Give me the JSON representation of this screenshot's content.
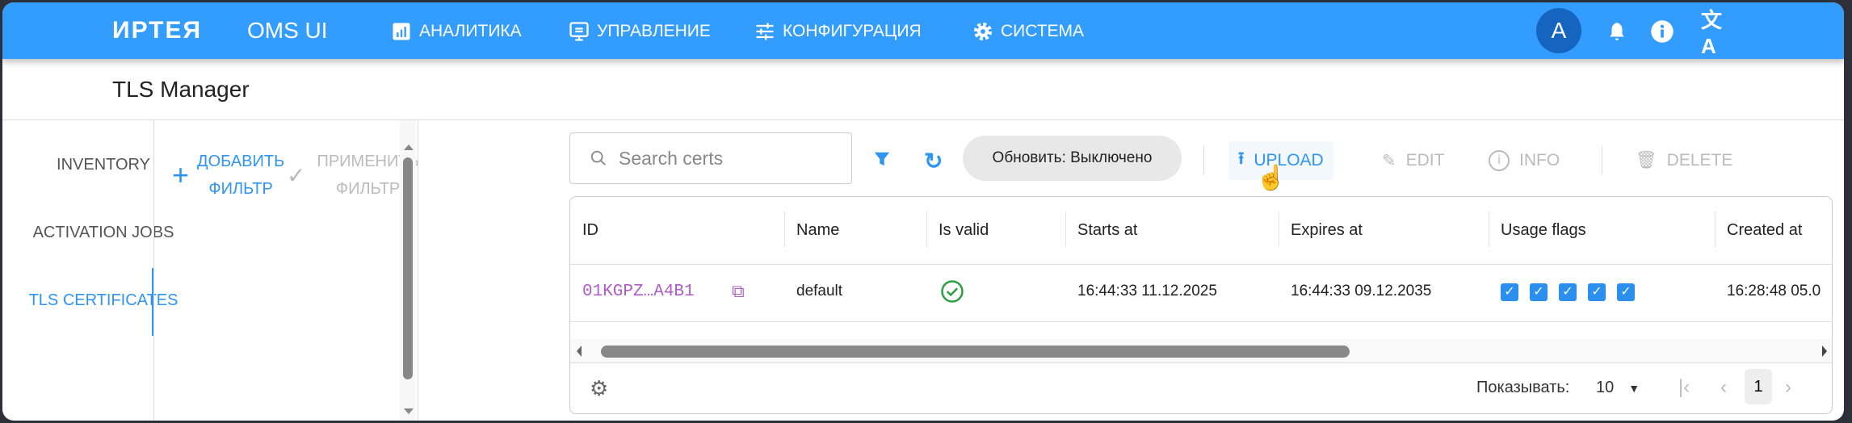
{
  "header": {
    "logo": "ИРТЕЯ",
    "app_name": "OMS UI",
    "nav": [
      {
        "label": "АНАЛИТИКА",
        "icon": "chart-icon"
      },
      {
        "label": "УПРАВЛЕНИЕ",
        "icon": "monitor-icon"
      },
      {
        "label": "КОНФИГУРАЦИЯ",
        "icon": "sliders-icon"
      },
      {
        "label": "СИСТЕМА",
        "icon": "gear-icon"
      }
    ],
    "avatar": "A"
  },
  "page_title": "TLS Manager",
  "sidebar": {
    "items": [
      {
        "label": "INVENTORY"
      },
      {
        "label": "ACTIVATION JOBS"
      },
      {
        "label": "TLS CERTIFICATES",
        "active": true
      }
    ]
  },
  "filters": {
    "add_line1": "ДОБАВИТЬ",
    "add_line2": "ФИЛЬТР",
    "apply_line1": "ПРИМЕНИТЬ",
    "apply_line2": "ФИЛЬТР"
  },
  "toolbar": {
    "search_placeholder": "Search certs",
    "refresh_chip": "Обновить: Выключено",
    "upload": "UPLOAD",
    "edit": "EDIT",
    "info": "INFO",
    "delete": "DELETE"
  },
  "table": {
    "columns": [
      "ID",
      "Name",
      "Is valid",
      "Starts at",
      "Expires at",
      "Usage flags",
      "Created at"
    ],
    "rows": [
      {
        "id": "01KGPZ…A4B1",
        "name": "default",
        "is_valid": true,
        "starts_at": "16:44:33 11.12.2025",
        "expires_at": "16:44:33 09.12.2035",
        "usage_flags": [
          true,
          true,
          true,
          true,
          true
        ],
        "created_at": "16:28:48 05.0"
      }
    ]
  },
  "footer": {
    "rows_label": "Показывать:",
    "rows_value": "10",
    "page": "1"
  },
  "colors": {
    "primary": "#339cff",
    "avatar": "#1565c0",
    "id_text": "#b05cc8",
    "valid": "#2e9e44"
  }
}
